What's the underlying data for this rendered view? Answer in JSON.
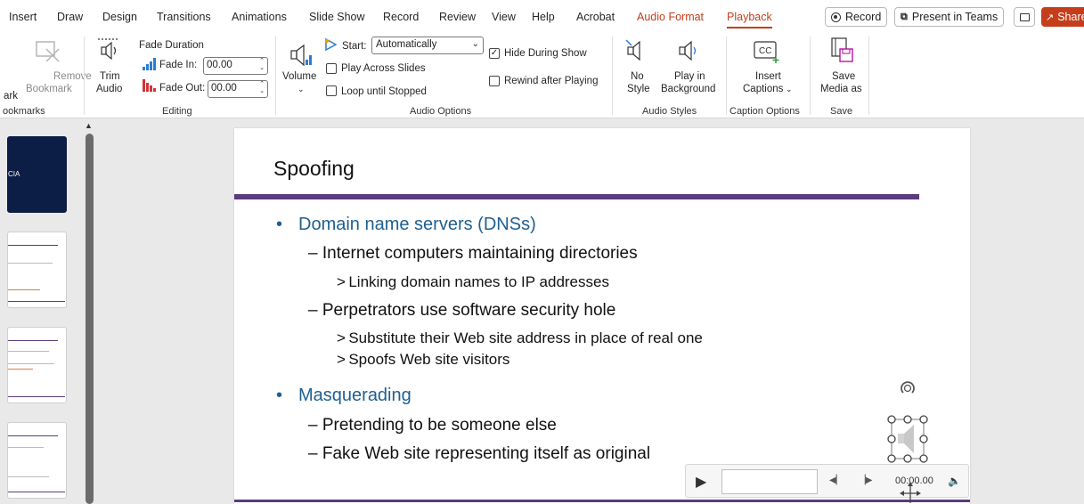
{
  "tabs": [
    "Insert",
    "Draw",
    "Design",
    "Transitions",
    "Animations",
    "Slide Show",
    "Record",
    "Review",
    "View",
    "Help",
    "Acrobat",
    "Audio Format",
    "Playback"
  ],
  "active_tab": "Playback",
  "titlebar_buttons": {
    "record": "Record",
    "present": "Present in Teams",
    "share": "Share"
  },
  "ribbon": {
    "bookmarks": {
      "add_label": "ark",
      "remove_label_1": "Remove",
      "remove_label_2": "Bookmark",
      "group": "ookmarks"
    },
    "editing": {
      "trim_label_1": "Trim",
      "trim_label_2": "Audio",
      "fade_duration": "Fade Duration",
      "fade_in_label": "Fade In:",
      "fade_in_value": "00.00",
      "fade_out_label": "Fade Out:",
      "fade_out_value": "00.00",
      "group": "Editing"
    },
    "audio_options": {
      "volume_label": "Volume",
      "start_label": "Start:",
      "start_value": "Automatically",
      "play_across_slides": "Play Across Slides",
      "loop_until_stopped": "Loop until Stopped",
      "hide_during_show": "Hide During Show",
      "rewind_after_playing": "Rewind after Playing",
      "group": "Audio Options"
    },
    "audio_styles": {
      "no_style_1": "No",
      "no_style_2": "Style",
      "play_bg_1": "Play in",
      "play_bg_2": "Background",
      "group": "Audio Styles"
    },
    "caption_options": {
      "insert_1": "Insert",
      "insert_2": "Captions",
      "group": "Caption Options"
    },
    "save": {
      "save_1": "Save",
      "save_2": "Media as",
      "group": "Save"
    }
  },
  "thumbnails": {
    "first_text": "CIA"
  },
  "slide": {
    "title": "Spoofing",
    "b1": "Domain name servers (DNSs)",
    "b1_1": "– Internet computers maintaining directories",
    "b1_1_1": "> Linking domain names to IP addresses",
    "b1_2": "– Perpetrators use software security hole",
    "b1_2_1": "> Substitute their Web site address in place of real one",
    "b1_2_2": "> Spoofs Web site visitors",
    "b2": "Masquerading",
    "b2_1": "– Pretending to be someone else",
    "b2_2": "– Fake Web site representing itself as original",
    "bullet_char": "•"
  },
  "audio_player": {
    "time": "00:00.00"
  },
  "colors": {
    "accent": "#c43e1c",
    "slide_bar": "#5b3b7e",
    "bullet_text": "#1f5f8f"
  }
}
